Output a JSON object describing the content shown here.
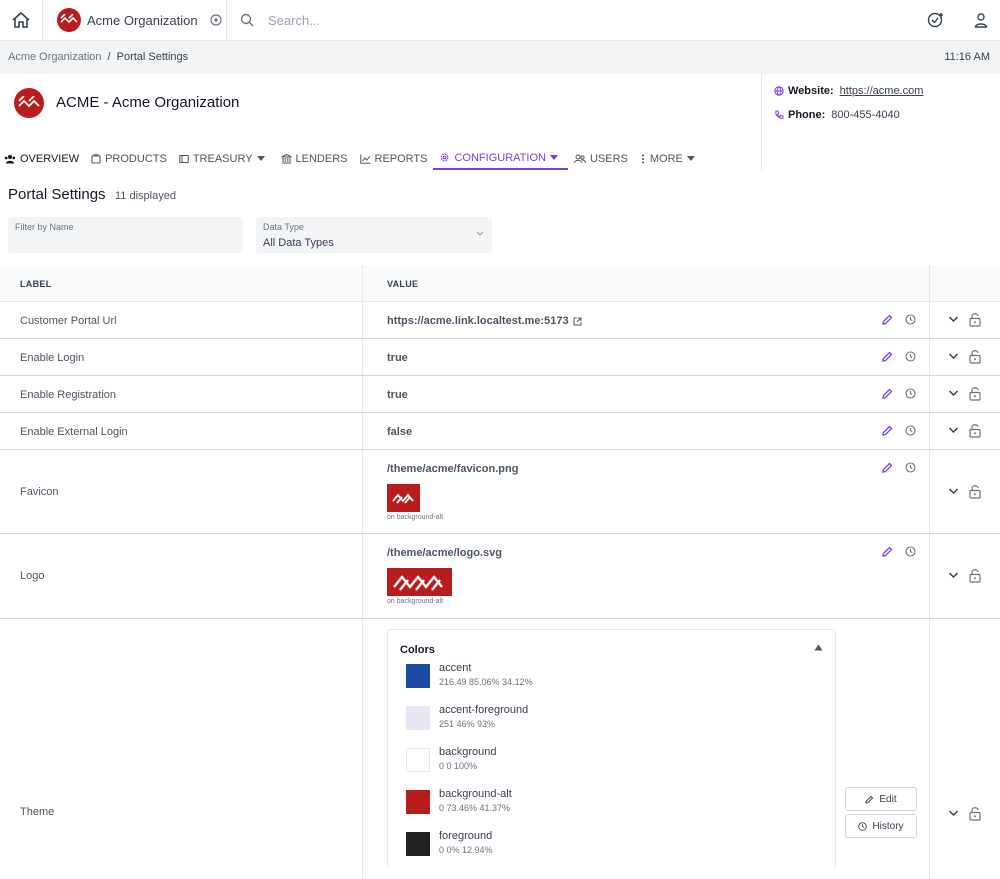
{
  "topbar": {
    "org_name": "Acme Organization",
    "search_placeholder": "Search..."
  },
  "breadcrumb": {
    "items": [
      "Acme Organization",
      "Portal Settings"
    ],
    "separator": "/"
  },
  "time": "11:16 AM",
  "org_header": {
    "title": "ACME - Acme Organization",
    "website_label": "Website:",
    "website": "https://acme.com",
    "phone_label": "Phone:",
    "phone": "800-455-4040"
  },
  "tabs": [
    {
      "label": "OVERVIEW",
      "icon": "users-icon"
    },
    {
      "label": "PRODUCTS",
      "icon": "products-icon"
    },
    {
      "label": "TREASURY",
      "icon": "treasury-icon",
      "dropdown": true
    },
    {
      "label": "LENDERS",
      "icon": "bank-icon"
    },
    {
      "label": "REPORTS",
      "icon": "chart-icon"
    },
    {
      "label": "CONFIGURATION",
      "icon": "gear-icon",
      "dropdown": true,
      "active": true
    },
    {
      "label": "USERS",
      "icon": "users-icon"
    },
    {
      "label": "MORE",
      "icon": "dots-vertical-icon",
      "dropdown": true
    }
  ],
  "page": {
    "title": "Portal Settings",
    "count": "11 displayed"
  },
  "filters": {
    "name_label": "Filter by Name",
    "name_value": "",
    "type_label": "Data Type",
    "type_value": "All Data Types"
  },
  "table": {
    "headers": {
      "label": "LABEL",
      "value": "VALUE"
    },
    "rows": [
      {
        "label": "Customer Portal Url",
        "value": "https://acme.link.localtest.me:5173"
      },
      {
        "label": "Enable Login",
        "value": "true"
      },
      {
        "label": "Enable Registration",
        "value": "true"
      },
      {
        "label": "Enable External Login",
        "value": "false"
      },
      {
        "label": "Favicon",
        "value": "/theme/acme/favicon.png",
        "caption": "on background-alt"
      },
      {
        "label": "Logo",
        "value": "/theme/acme/logo.svg",
        "caption": "on background-alt"
      },
      {
        "label": "Theme",
        "value": ""
      }
    ]
  },
  "theme": {
    "colors_title": "Colors",
    "colors": [
      {
        "name": "accent",
        "value": "216.49 85.06% 34.12%",
        "hex": "#1a4aa1"
      },
      {
        "name": "accent-foreground",
        "value": "251 46% 93%",
        "hex": "#e8e5f4"
      },
      {
        "name": "background",
        "value": "0 0 100%",
        "hex": "#ffffff"
      },
      {
        "name": "background-alt",
        "value": "0 73.46% 41.37%",
        "hex": "#b81c1c"
      },
      {
        "name": "foreground",
        "value": "0 0% 12.94%",
        "hex": "#212121"
      }
    ],
    "edit_label": "Edit",
    "history_label": "History"
  },
  "colors": {
    "brand": "#b91c1c",
    "active_tab": "#7c3aed"
  }
}
